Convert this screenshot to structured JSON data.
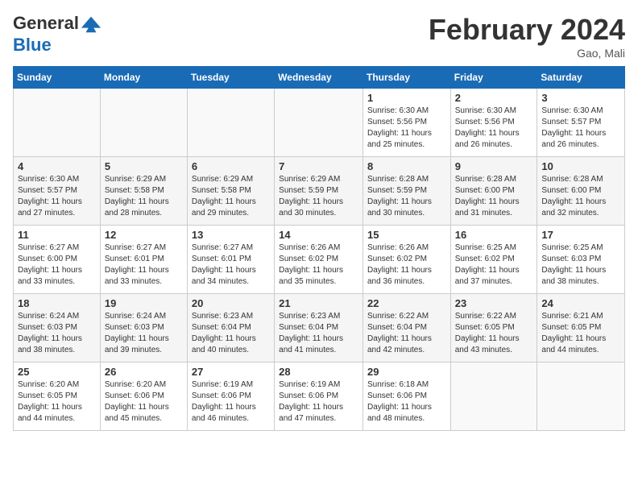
{
  "header": {
    "logo_general": "General",
    "logo_blue": "Blue",
    "month_year": "February 2024",
    "location": "Gao, Mali"
  },
  "weekdays": [
    "Sunday",
    "Monday",
    "Tuesday",
    "Wednesday",
    "Thursday",
    "Friday",
    "Saturday"
  ],
  "weeks": [
    [
      {
        "day": "",
        "sunrise": "",
        "sunset": "",
        "daylight": ""
      },
      {
        "day": "",
        "sunrise": "",
        "sunset": "",
        "daylight": ""
      },
      {
        "day": "",
        "sunrise": "",
        "sunset": "",
        "daylight": ""
      },
      {
        "day": "",
        "sunrise": "",
        "sunset": "",
        "daylight": ""
      },
      {
        "day": "1",
        "sunrise": "Sunrise: 6:30 AM",
        "sunset": "Sunset: 5:56 PM",
        "daylight": "Daylight: 11 hours and 25 minutes."
      },
      {
        "day": "2",
        "sunrise": "Sunrise: 6:30 AM",
        "sunset": "Sunset: 5:56 PM",
        "daylight": "Daylight: 11 hours and 26 minutes."
      },
      {
        "day": "3",
        "sunrise": "Sunrise: 6:30 AM",
        "sunset": "Sunset: 5:57 PM",
        "daylight": "Daylight: 11 hours and 26 minutes."
      }
    ],
    [
      {
        "day": "4",
        "sunrise": "Sunrise: 6:30 AM",
        "sunset": "Sunset: 5:57 PM",
        "daylight": "Daylight: 11 hours and 27 minutes."
      },
      {
        "day": "5",
        "sunrise": "Sunrise: 6:29 AM",
        "sunset": "Sunset: 5:58 PM",
        "daylight": "Daylight: 11 hours and 28 minutes."
      },
      {
        "day": "6",
        "sunrise": "Sunrise: 6:29 AM",
        "sunset": "Sunset: 5:58 PM",
        "daylight": "Daylight: 11 hours and 29 minutes."
      },
      {
        "day": "7",
        "sunrise": "Sunrise: 6:29 AM",
        "sunset": "Sunset: 5:59 PM",
        "daylight": "Daylight: 11 hours and 30 minutes."
      },
      {
        "day": "8",
        "sunrise": "Sunrise: 6:28 AM",
        "sunset": "Sunset: 5:59 PM",
        "daylight": "Daylight: 11 hours and 30 minutes."
      },
      {
        "day": "9",
        "sunrise": "Sunrise: 6:28 AM",
        "sunset": "Sunset: 6:00 PM",
        "daylight": "Daylight: 11 hours and 31 minutes."
      },
      {
        "day": "10",
        "sunrise": "Sunrise: 6:28 AM",
        "sunset": "Sunset: 6:00 PM",
        "daylight": "Daylight: 11 hours and 32 minutes."
      }
    ],
    [
      {
        "day": "11",
        "sunrise": "Sunrise: 6:27 AM",
        "sunset": "Sunset: 6:00 PM",
        "daylight": "Daylight: 11 hours and 33 minutes."
      },
      {
        "day": "12",
        "sunrise": "Sunrise: 6:27 AM",
        "sunset": "Sunset: 6:01 PM",
        "daylight": "Daylight: 11 hours and 33 minutes."
      },
      {
        "day": "13",
        "sunrise": "Sunrise: 6:27 AM",
        "sunset": "Sunset: 6:01 PM",
        "daylight": "Daylight: 11 hours and 34 minutes."
      },
      {
        "day": "14",
        "sunrise": "Sunrise: 6:26 AM",
        "sunset": "Sunset: 6:02 PM",
        "daylight": "Daylight: 11 hours and 35 minutes."
      },
      {
        "day": "15",
        "sunrise": "Sunrise: 6:26 AM",
        "sunset": "Sunset: 6:02 PM",
        "daylight": "Daylight: 11 hours and 36 minutes."
      },
      {
        "day": "16",
        "sunrise": "Sunrise: 6:25 AM",
        "sunset": "Sunset: 6:02 PM",
        "daylight": "Daylight: 11 hours and 37 minutes."
      },
      {
        "day": "17",
        "sunrise": "Sunrise: 6:25 AM",
        "sunset": "Sunset: 6:03 PM",
        "daylight": "Daylight: 11 hours and 38 minutes."
      }
    ],
    [
      {
        "day": "18",
        "sunrise": "Sunrise: 6:24 AM",
        "sunset": "Sunset: 6:03 PM",
        "daylight": "Daylight: 11 hours and 38 minutes."
      },
      {
        "day": "19",
        "sunrise": "Sunrise: 6:24 AM",
        "sunset": "Sunset: 6:03 PM",
        "daylight": "Daylight: 11 hours and 39 minutes."
      },
      {
        "day": "20",
        "sunrise": "Sunrise: 6:23 AM",
        "sunset": "Sunset: 6:04 PM",
        "daylight": "Daylight: 11 hours and 40 minutes."
      },
      {
        "day": "21",
        "sunrise": "Sunrise: 6:23 AM",
        "sunset": "Sunset: 6:04 PM",
        "daylight": "Daylight: 11 hours and 41 minutes."
      },
      {
        "day": "22",
        "sunrise": "Sunrise: 6:22 AM",
        "sunset": "Sunset: 6:04 PM",
        "daylight": "Daylight: 11 hours and 42 minutes."
      },
      {
        "day": "23",
        "sunrise": "Sunrise: 6:22 AM",
        "sunset": "Sunset: 6:05 PM",
        "daylight": "Daylight: 11 hours and 43 minutes."
      },
      {
        "day": "24",
        "sunrise": "Sunrise: 6:21 AM",
        "sunset": "Sunset: 6:05 PM",
        "daylight": "Daylight: 11 hours and 44 minutes."
      }
    ],
    [
      {
        "day": "25",
        "sunrise": "Sunrise: 6:20 AM",
        "sunset": "Sunset: 6:05 PM",
        "daylight": "Daylight: 11 hours and 44 minutes."
      },
      {
        "day": "26",
        "sunrise": "Sunrise: 6:20 AM",
        "sunset": "Sunset: 6:06 PM",
        "daylight": "Daylight: 11 hours and 45 minutes."
      },
      {
        "day": "27",
        "sunrise": "Sunrise: 6:19 AM",
        "sunset": "Sunset: 6:06 PM",
        "daylight": "Daylight: 11 hours and 46 minutes."
      },
      {
        "day": "28",
        "sunrise": "Sunrise: 6:19 AM",
        "sunset": "Sunset: 6:06 PM",
        "daylight": "Daylight: 11 hours and 47 minutes."
      },
      {
        "day": "29",
        "sunrise": "Sunrise: 6:18 AM",
        "sunset": "Sunset: 6:06 PM",
        "daylight": "Daylight: 11 hours and 48 minutes."
      },
      {
        "day": "",
        "sunrise": "",
        "sunset": "",
        "daylight": ""
      },
      {
        "day": "",
        "sunrise": "",
        "sunset": "",
        "daylight": ""
      }
    ]
  ]
}
